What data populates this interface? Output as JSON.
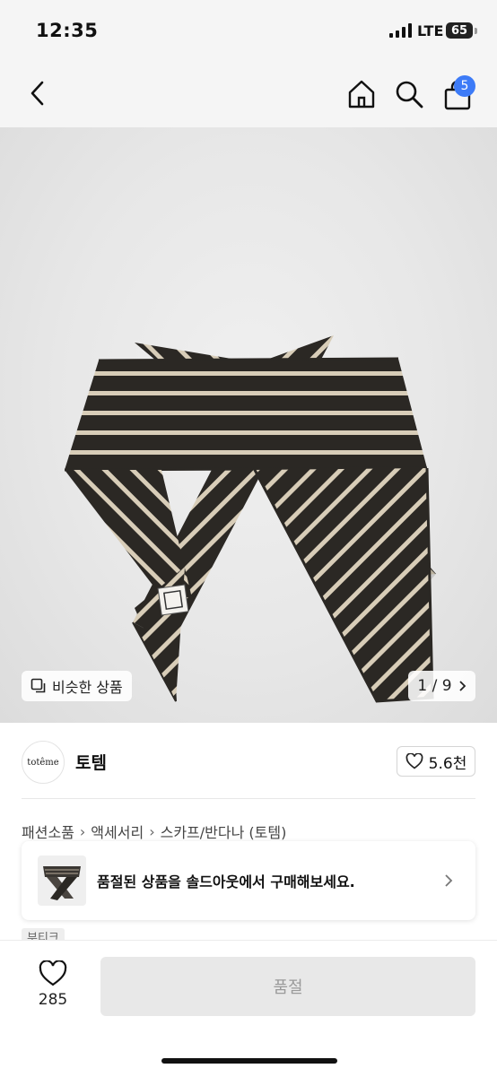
{
  "status_bar": {
    "time": "12:35",
    "network": "LTE",
    "battery": "65"
  },
  "nav": {
    "cart_count": "5",
    "icons": [
      "back-icon",
      "home-icon",
      "search-icon",
      "cart-icon"
    ]
  },
  "product_image": {
    "similar_label": "비슷한 상품",
    "counter": "1 / 9"
  },
  "brand": {
    "logo_text": "totême",
    "name": "토템",
    "like_count": "5.6천"
  },
  "breadcrumb": [
    "패션소품",
    "액세서리",
    "스카프/반다나 (토템)"
  ],
  "soldout_banner": {
    "text": "품절된 상품을 솔드아웃에서 구매해보세요."
  },
  "tag_peek": "부티크",
  "bottom_bar": {
    "wish_count": "285",
    "action_label": "품절"
  },
  "colors": {
    "accent": "#3d7bf7",
    "scarf_dark": "#2b2824",
    "scarf_light": "#d8cdb8",
    "disabled_bg": "#e8e8e8"
  }
}
